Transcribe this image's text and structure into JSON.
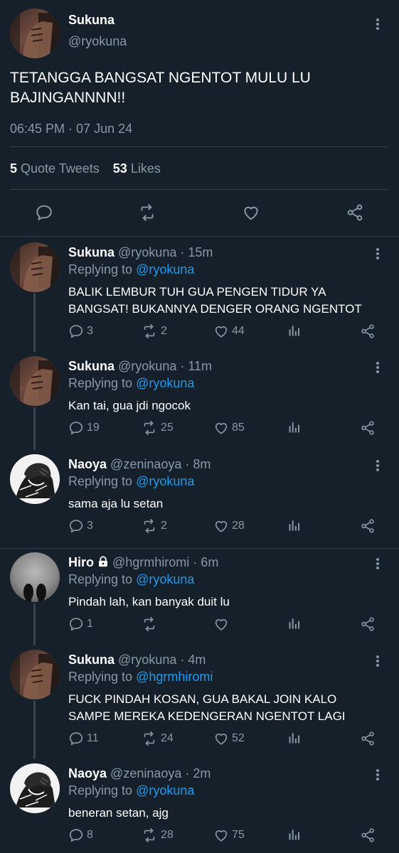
{
  "main_tweet": {
    "name": "Sukuna",
    "handle": "@ryokuna",
    "text": "TETANGGA BANGSAT NGENTOT MULU LU BAJINGANNNN!!",
    "timestamp": "06:45 PM · 07 Jun 24",
    "quote_count": "5",
    "quote_label": "Quote Tweets",
    "like_count": "53",
    "like_label": "Likes"
  },
  "replies": [
    {
      "name": "Sukuna",
      "handle": "@ryokuna",
      "time": "· 15m",
      "replying_prefix": "Replying to",
      "replying_to": "@ryokuna",
      "text": "BALIK LEMBUR TUH GUA PENGEN TIDUR YA BANGSAT! BUKANNYA DENGER ORANG NGENTOT",
      "replies": "3",
      "retweets": "2",
      "likes": "44",
      "avatar": "sukuna"
    },
    {
      "name": "Sukuna",
      "handle": "@ryokuna",
      "time": "· 11m",
      "replying_prefix": "Replying to",
      "replying_to": "@ryokuna",
      "text": "Kan tai, gua jdi ngocok",
      "replies": "19",
      "retweets": "25",
      "likes": "85",
      "avatar": "sukuna"
    },
    {
      "name": "Naoya",
      "handle": "@zeninaoya",
      "time": "· 8m",
      "replying_prefix": "Replying to",
      "replying_to": "@ryokuna",
      "text": "sama aja lu setan",
      "replies": "3",
      "retweets": "2",
      "likes": "28",
      "avatar": "naoya"
    },
    {
      "name": "Hiro",
      "handle": "@hgrmhiromi",
      "time": "· 6m",
      "replying_prefix": "Replying to",
      "replying_to": "@ryokuna",
      "text": "Pindah lah, kan banyak duit lu",
      "replies": "1",
      "retweets": "",
      "likes": "",
      "avatar": "hiro",
      "locked": true
    },
    {
      "name": "Sukuna",
      "handle": "@ryokuna",
      "time": "· 4m",
      "replying_prefix": "Replying to",
      "replying_to": "@hgrmhiromi",
      "text": "FUCK PINDAH KOSAN, GUA BAKAL JOIN KALO SAMPE MEREKA KEDENGERAN NGENTOT LAGI",
      "replies": "11",
      "retweets": "24",
      "likes": "52",
      "avatar": "sukuna"
    },
    {
      "name": "Naoya",
      "handle": "@zeninaoya",
      "time": "· 2m",
      "replying_prefix": "Replying to",
      "replying_to": "@ryokuna",
      "text": "beneran setan, ajg",
      "replies": "8",
      "retweets": "28",
      "likes": "75",
      "avatar": "naoya"
    }
  ],
  "icons": {
    "reply": "reply-icon",
    "retweet": "retweet-icon",
    "like": "like-icon",
    "analytics": "analytics-icon",
    "share": "share-icon",
    "more": "more-icon",
    "lock": "lock-icon"
  },
  "colors": {
    "background": "#15202b",
    "muted": "#8899a6",
    "link": "#1d9bf0",
    "divider": "#38444d"
  }
}
